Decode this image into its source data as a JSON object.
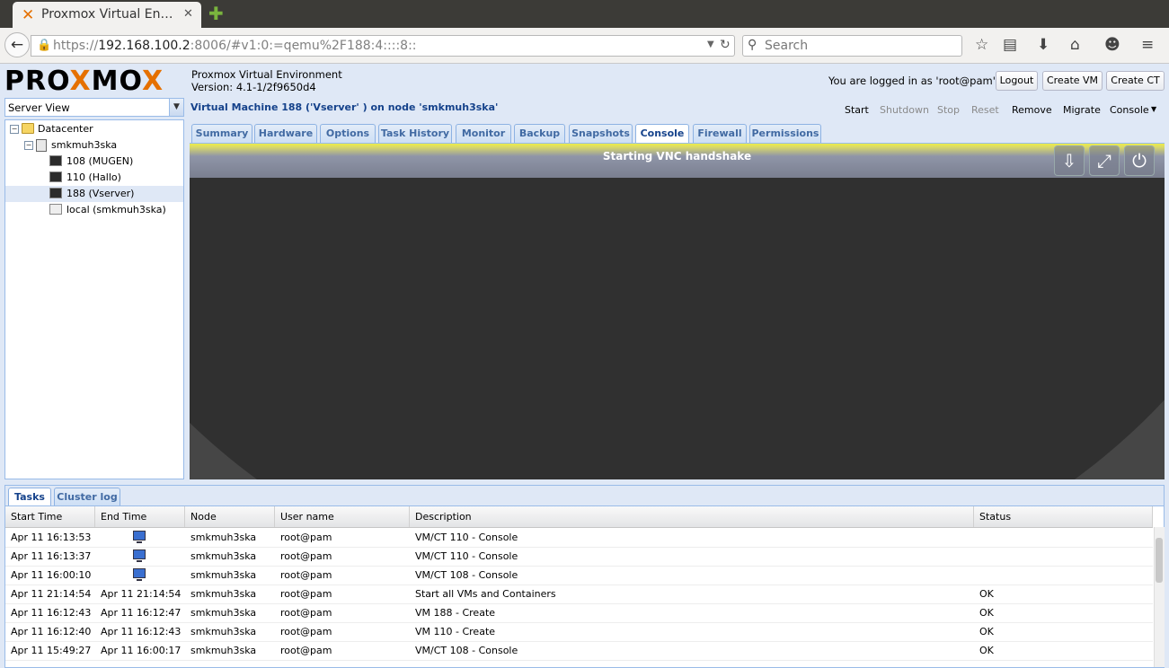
{
  "browser": {
    "tab_title": "Proxmox Virtual En…",
    "tab_favicon": "✕",
    "url_prefix": "https://",
    "url_host": "192.168.100.2",
    "url_rest": ":8006/#v1:0:=qemu%2F188:4::::8::",
    "search_placeholder": "Search"
  },
  "app": {
    "logo_a": "PRO",
    "logo_x": "X",
    "logo_b": "MO",
    "logo_x2": "X",
    "product_name": "Proxmox Virtual Environment",
    "version": "Version: 4.1-1/2f9650d4",
    "logged_in": "You are logged in as 'root@pam'",
    "logout": "Logout",
    "create_vm": "Create VM",
    "create_ct": "Create CT"
  },
  "sidebar": {
    "view": "Server View",
    "tree": [
      {
        "label": "Datacenter"
      },
      {
        "label": "smkmuh3ska"
      },
      {
        "label": "108 (MUGEN)"
      },
      {
        "label": "110 (Hallo)"
      },
      {
        "label": "188 (Vserver)"
      },
      {
        "label": "local (smkmuh3ska)"
      }
    ]
  },
  "vm": {
    "title": "Virtual Machine 188 ('Vserver' ) on node 'smkmuh3ska'",
    "toolbar": [
      "Start",
      "Shutdown",
      "Stop",
      "Reset",
      "Remove",
      "Migrate",
      "Console"
    ],
    "tabs": [
      "Summary",
      "Hardware",
      "Options",
      "Task History",
      "Monitor",
      "Backup",
      "Snapshots",
      "Console",
      "Firewall",
      "Permissions"
    ],
    "active_tab": "Console",
    "vnc_status": "Starting VNC handshake"
  },
  "bottom": {
    "tabs": [
      "Tasks",
      "Cluster log"
    ],
    "columns": [
      "Start Time",
      "End Time",
      "Node",
      "User name",
      "Description",
      "Status"
    ],
    "rows": [
      {
        "start": "Apr 11 16:13:53",
        "end": "",
        "node": "smkmuh3ska",
        "user": "root@pam",
        "desc": "VM/CT 110 - Console",
        "status": ""
      },
      {
        "start": "Apr 11 16:13:37",
        "end": "",
        "node": "smkmuh3ska",
        "user": "root@pam",
        "desc": "VM/CT 110 - Console",
        "status": ""
      },
      {
        "start": "Apr 11 16:00:10",
        "end": "",
        "node": "smkmuh3ska",
        "user": "root@pam",
        "desc": "VM/CT 108 - Console",
        "status": ""
      },
      {
        "start": "Apr 11 21:14:54",
        "end": "Apr 11 21:14:54",
        "node": "smkmuh3ska",
        "user": "root@pam",
        "desc": "Start all VMs and Containers",
        "status": "OK"
      },
      {
        "start": "Apr 11 16:12:43",
        "end": "Apr 11 16:12:47",
        "node": "smkmuh3ska",
        "user": "root@pam",
        "desc": "VM 188 - Create",
        "status": "OK"
      },
      {
        "start": "Apr 11 16:12:40",
        "end": "Apr 11 16:12:43",
        "node": "smkmuh3ska",
        "user": "root@pam",
        "desc": "VM 110 - Create",
        "status": "OK"
      },
      {
        "start": "Apr 11 15:49:27",
        "end": "Apr 11 16:00:17",
        "node": "smkmuh3ska",
        "user": "root@pam",
        "desc": "VM/CT 108 - Console",
        "status": "OK"
      }
    ]
  },
  "colors": {
    "accent": "#e57000",
    "header_bg": "#dfe8f6",
    "tab_text": "#15428b"
  }
}
